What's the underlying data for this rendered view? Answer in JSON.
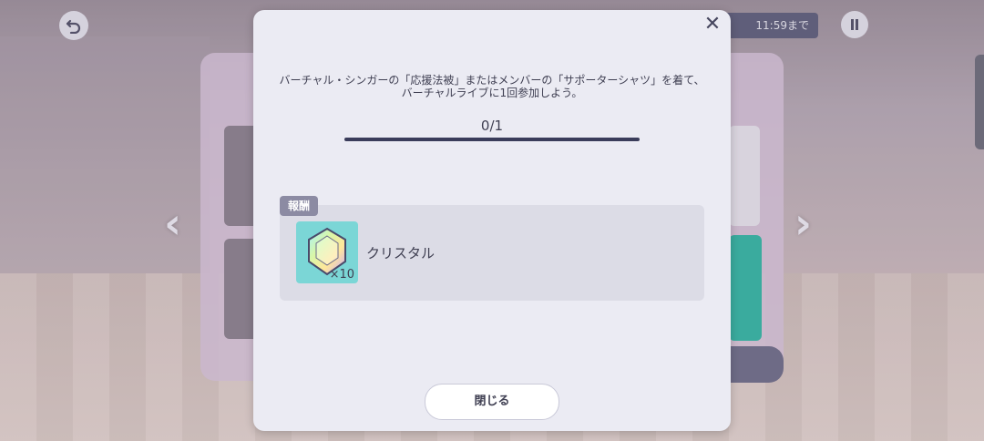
{
  "hud": {
    "deadline_fragment": "11:59まで"
  },
  "modal": {
    "mission_line1": "バーチャル・シンガーの「応援法被」またはメンバーの「サポーターシャツ」を着て、",
    "mission_line2": "バーチャルライブに1回参加しよう。",
    "progress_text": "0/1",
    "progress_fraction": 0.0,
    "reward_tag": "報酬",
    "reward": {
      "name": "クリスタル",
      "quantity": "×10",
      "icon": "crystal-icon"
    },
    "close_button_label": "閉じる"
  },
  "colors": {
    "modal_bg": "#ebebf3",
    "accent": "#3a3c5a",
    "reward_tag": "#8c8ba3",
    "crystal_bg": "#7bd6d6"
  }
}
